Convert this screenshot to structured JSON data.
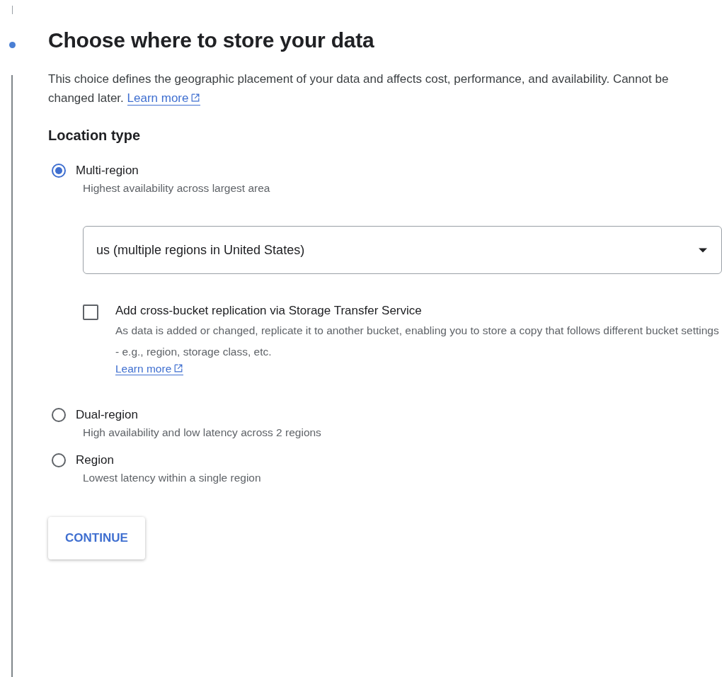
{
  "step": {
    "title": "Choose where to store your data",
    "description": "This choice defines the geographic placement of your data and affects cost, performance, and availability. Cannot be changed later.",
    "learn_more": "Learn more"
  },
  "location_type": {
    "heading": "Location type",
    "options": [
      {
        "label": "Multi-region",
        "hint": "Highest availability across largest area",
        "selected": true,
        "dropdown": {
          "value": "us (multiple regions in United States)"
        },
        "replication": {
          "checked": false,
          "label": "Add cross-bucket replication via Storage Transfer Service",
          "description": "As data is added or changed, replicate it to another bucket, enabling you to store a copy that follows different bucket settings - e.g., region, storage class, etc.",
          "learn_more": "Learn more"
        }
      },
      {
        "label": "Dual-region",
        "hint": "High availability and low latency across 2 regions",
        "selected": false
      },
      {
        "label": "Region",
        "hint": "Lowest latency within a single region",
        "selected": false
      }
    ]
  },
  "continue_button": "CONTINUE"
}
